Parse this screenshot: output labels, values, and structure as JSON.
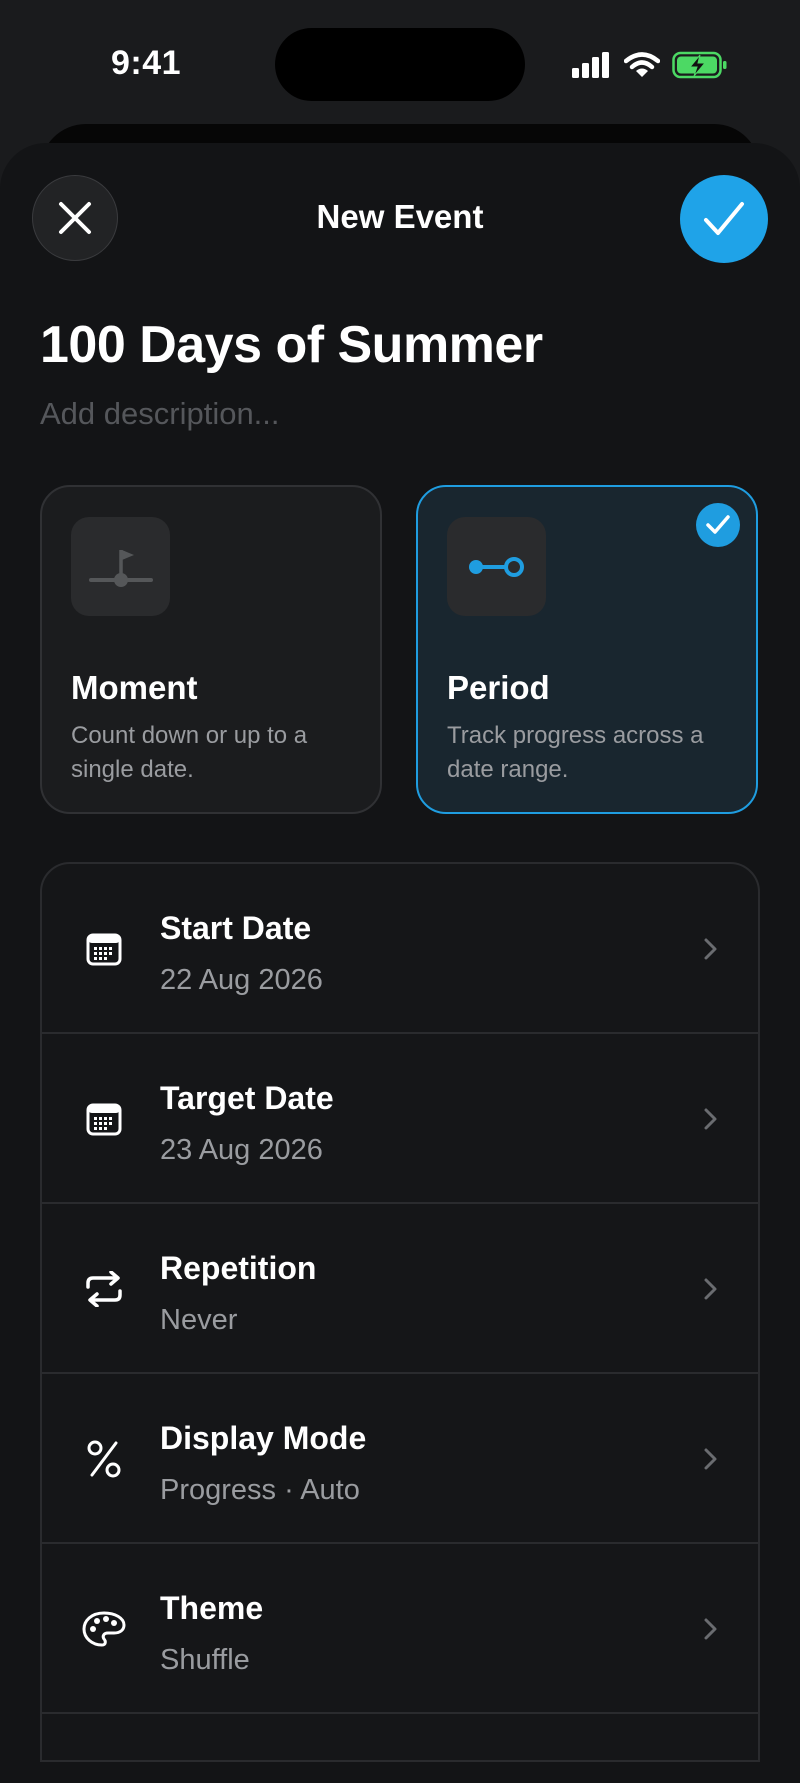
{
  "status_bar": {
    "time": "9:41"
  },
  "nav": {
    "title": "New Event"
  },
  "event": {
    "title": "100 Days of Summer",
    "description_placeholder": "Add description..."
  },
  "event_types": [
    {
      "title": "Moment",
      "description": "Count down or up to a single date.",
      "icon": "flag-timeline-icon",
      "selected": false
    },
    {
      "title": "Period",
      "description": "Track progress across a date range.",
      "icon": "range-icon",
      "selected": true
    }
  ],
  "settings": [
    {
      "label": "Start Date",
      "value": "22 Aug 2026",
      "icon": "calendar-icon"
    },
    {
      "label": "Target Date",
      "value": "23 Aug 2026",
      "icon": "calendar-icon"
    },
    {
      "label": "Repetition",
      "value": "Never",
      "icon": "repeat-icon"
    },
    {
      "label": "Display Mode",
      "value": "Progress · Auto",
      "icon": "percent-icon"
    },
    {
      "label": "Theme",
      "value": "Shuffle",
      "icon": "palette-icon"
    }
  ],
  "colors": {
    "accent": "#1fa3e8",
    "background": "#131416",
    "secondary_text": "#9a9ca0"
  }
}
